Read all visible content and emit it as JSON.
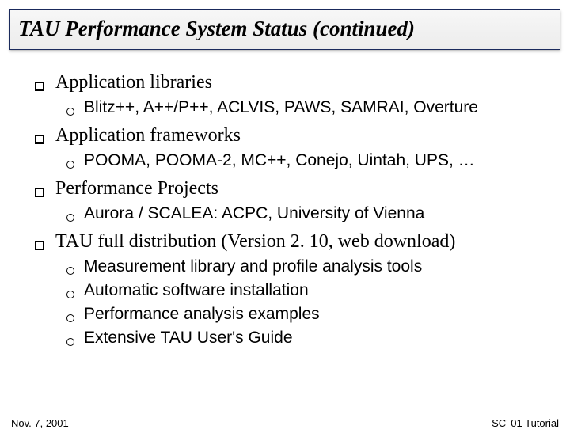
{
  "title": "TAU Performance System Status (continued)",
  "sections": [
    {
      "heading": "Application libraries",
      "items": [
        "Blitz++, A++/P++, ACLVIS, PAWS, SAMRAI, Overture"
      ]
    },
    {
      "heading": "Application frameworks",
      "items": [
        "POOMA, POOMA-2, MC++, Conejo, Uintah, UPS, …"
      ]
    },
    {
      "heading": "Performance Projects",
      "items": [
        "Aurora / SCALEA: ACPC, University of Vienna"
      ]
    },
    {
      "heading": "TAU full distribution (Version 2. 10, web download)",
      "items": [
        "Measurement library and profile analysis tools",
        "Automatic software installation",
        "Performance analysis examples",
        "Extensive TAU User's Guide"
      ]
    }
  ],
  "footer": {
    "left": "Nov. 7, 2001",
    "right": "SC' 01 Tutorial"
  }
}
